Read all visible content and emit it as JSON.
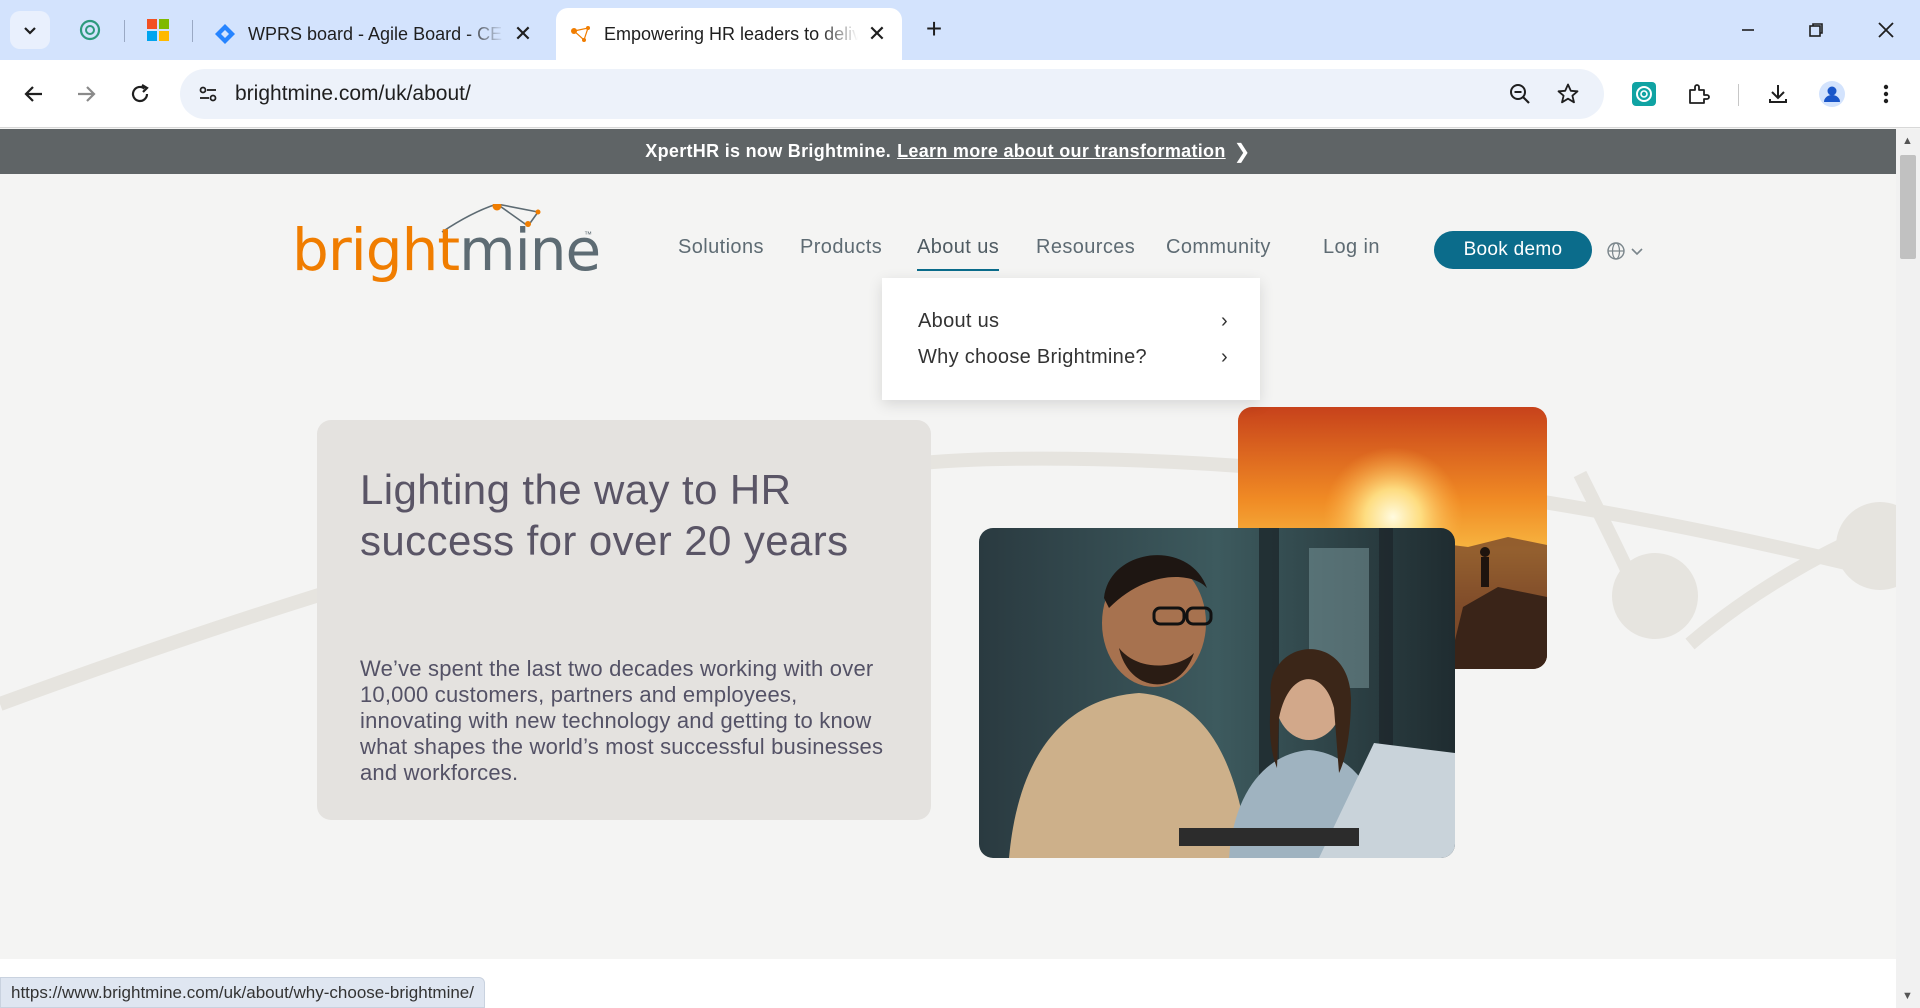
{
  "browser": {
    "tabs": [
      {
        "title": "WPRS board - Agile Board - CE",
        "icon": "jira-icon",
        "active": false
      },
      {
        "title": "Empowering HR leaders to deliver",
        "icon": "brightmine-favicon",
        "active": true
      }
    ],
    "pinned_icons": [
      "chatgpt-icon",
      "microsoft-icon"
    ],
    "url": "brightmine.com/uk/about/",
    "status_url": "https://www.brightmine.com/uk/about/why-choose-brightmine/"
  },
  "banner": {
    "text": "XpertHR is now Brightmine.",
    "link": "Learn more about our transformation",
    "chevron": "❯"
  },
  "logo": {
    "orange": "bright",
    "grey": "mine",
    "tm": "™"
  },
  "nav": {
    "solutions": "Solutions",
    "products": "Products",
    "about": "About us",
    "resources": "Resources",
    "community": "Community",
    "login": "Log in",
    "book_demo": "Book demo"
  },
  "dropdown": {
    "items": [
      {
        "label": "About us",
        "arrow": "›"
      },
      {
        "label": "Why choose Brightmine?",
        "arrow": "›"
      }
    ]
  },
  "hero": {
    "title": "Lighting the way to HR success for over 20 years",
    "text": "We’ve spent the last two decades working with over 10,000 customers, partners and employees, innovating with new technology and getting to know what shapes the world’s most successful businesses and workforces."
  },
  "colors": {
    "accent_teal": "#0b6c8b",
    "brand_orange": "#f07d00",
    "banner_grey": "#5f6466",
    "tab_bar": "#d3e3fd"
  }
}
